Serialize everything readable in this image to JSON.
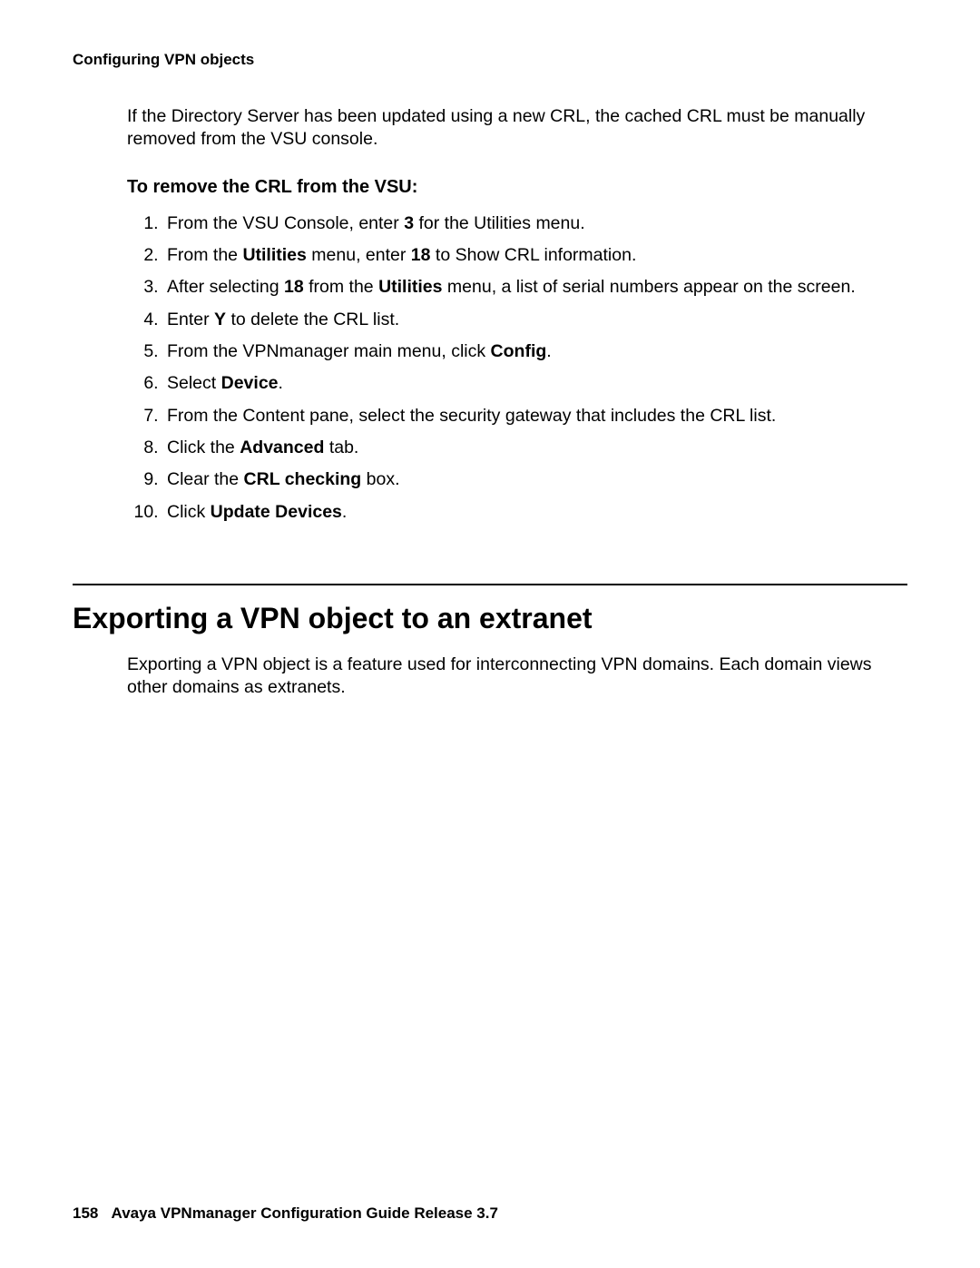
{
  "header": {
    "running_head": "Configuring VPN objects"
  },
  "intro": {
    "text": "If the Directory Server has been updated using a new CRL, the cached CRL must be manually removed from the VSU console."
  },
  "procedure": {
    "title": "To remove the CRL from the VSU:",
    "steps_html": [
      "From the VSU Console, enter <b>3</b> for the Utilities menu.",
      "From the <b>Utilities</b> menu, enter <b>18</b> to Show CRL information.",
      "After selecting <b>18</b> from the <b>Utilities</b> menu, a list of serial numbers appear on the screen.",
      "Enter <b>Y</b> to delete the CRL list.",
      "From the VPNmanager main menu, click <b>Config</b>.",
      "Select <b>Device</b>.",
      "From the Content pane, select the security gateway that includes the CRL list.",
      "Click the <b>Advanced</b> tab.",
      "Clear the <b>CRL checking</b> box.",
      "Click <b>Update Devices</b>."
    ]
  },
  "section": {
    "title": "Exporting a VPN object to an extranet",
    "body": "Exporting a VPN object is a feature used for interconnecting VPN domains. Each domain views other domains as extranets."
  },
  "footer": {
    "page_number": "158",
    "doc_title": "Avaya VPNmanager Configuration Guide Release 3.7"
  }
}
